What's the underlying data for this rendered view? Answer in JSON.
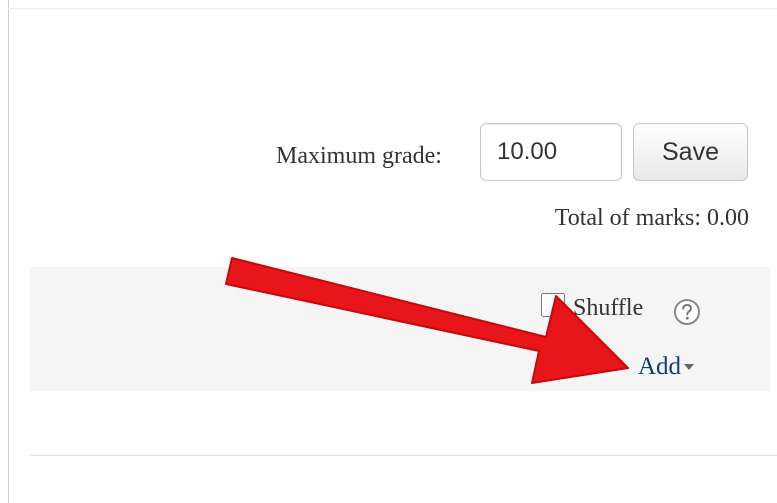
{
  "quiz_editor": {
    "maximum_grade": {
      "label": "Maximum grade:",
      "value": "10.00"
    },
    "save_button_label": "Save",
    "total_of_marks": {
      "label": "Total of marks:",
      "value": "0.00"
    },
    "section": {
      "shuffle_label": "Shuffle",
      "shuffle_checked": false,
      "help_icon": "question-circle-icon",
      "add_label": "Add"
    }
  },
  "annotation": {
    "arrow_color": "#e8161b",
    "arrow_target": "add-menu"
  },
  "colors": {
    "text": "#333333",
    "link": "#0f3d73",
    "section_background": "#f5f5f5"
  }
}
